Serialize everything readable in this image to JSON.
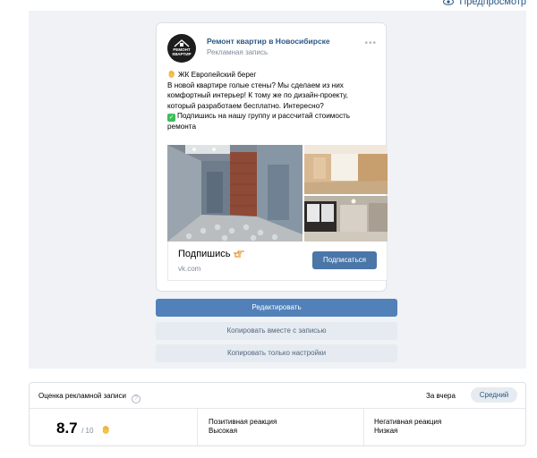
{
  "header": {
    "preview_label": "Предпросмотр"
  },
  "post": {
    "group_name": "Ремонт квартир в Новосибирске",
    "post_type": "Рекламная запись",
    "avatar_text": [
      "РЕМОНТ",
      "КВАРТИР"
    ],
    "text_lines": [
      "ЖК Европейский берег",
      "В новой квартире голые стены? Мы сделаем из них",
      "комфортный интерьер! К тому же по дизайн-проекту,",
      "который разработаем бесплатно. Интересно?",
      "Подпишись на нашу группу и рассчитай стоимость",
      "ремонта"
    ],
    "card": {
      "title": "Подпишись",
      "domain": "vk.com",
      "button_label": "Подписаться"
    }
  },
  "actions": {
    "edit_label": "Редактировать",
    "copy_with_post_label": "Копировать вместе с записью",
    "copy_settings_label": "Копировать только настройки"
  },
  "rating": {
    "title": "Оценка рекламной записи",
    "help_icon": "?",
    "period": "За вчера",
    "level": "Средний",
    "score": "8.7",
    "score_max": "/ 10",
    "positive_label": "Позитивная реакция",
    "positive_value": "Высокая",
    "negative_label": "Негативная реакция",
    "negative_value": "Низкая"
  },
  "colors": {
    "accent": "#5181b8",
    "link": "#2a5885",
    "secondary_button": "#e5ebf1",
    "stage_background": "#f0f2f5"
  },
  "icons": [
    "eye-icon",
    "more-icon",
    "hand-icon",
    "check-icon",
    "pointing-hand-icon",
    "help-icon",
    "fire-hand-icon"
  ]
}
